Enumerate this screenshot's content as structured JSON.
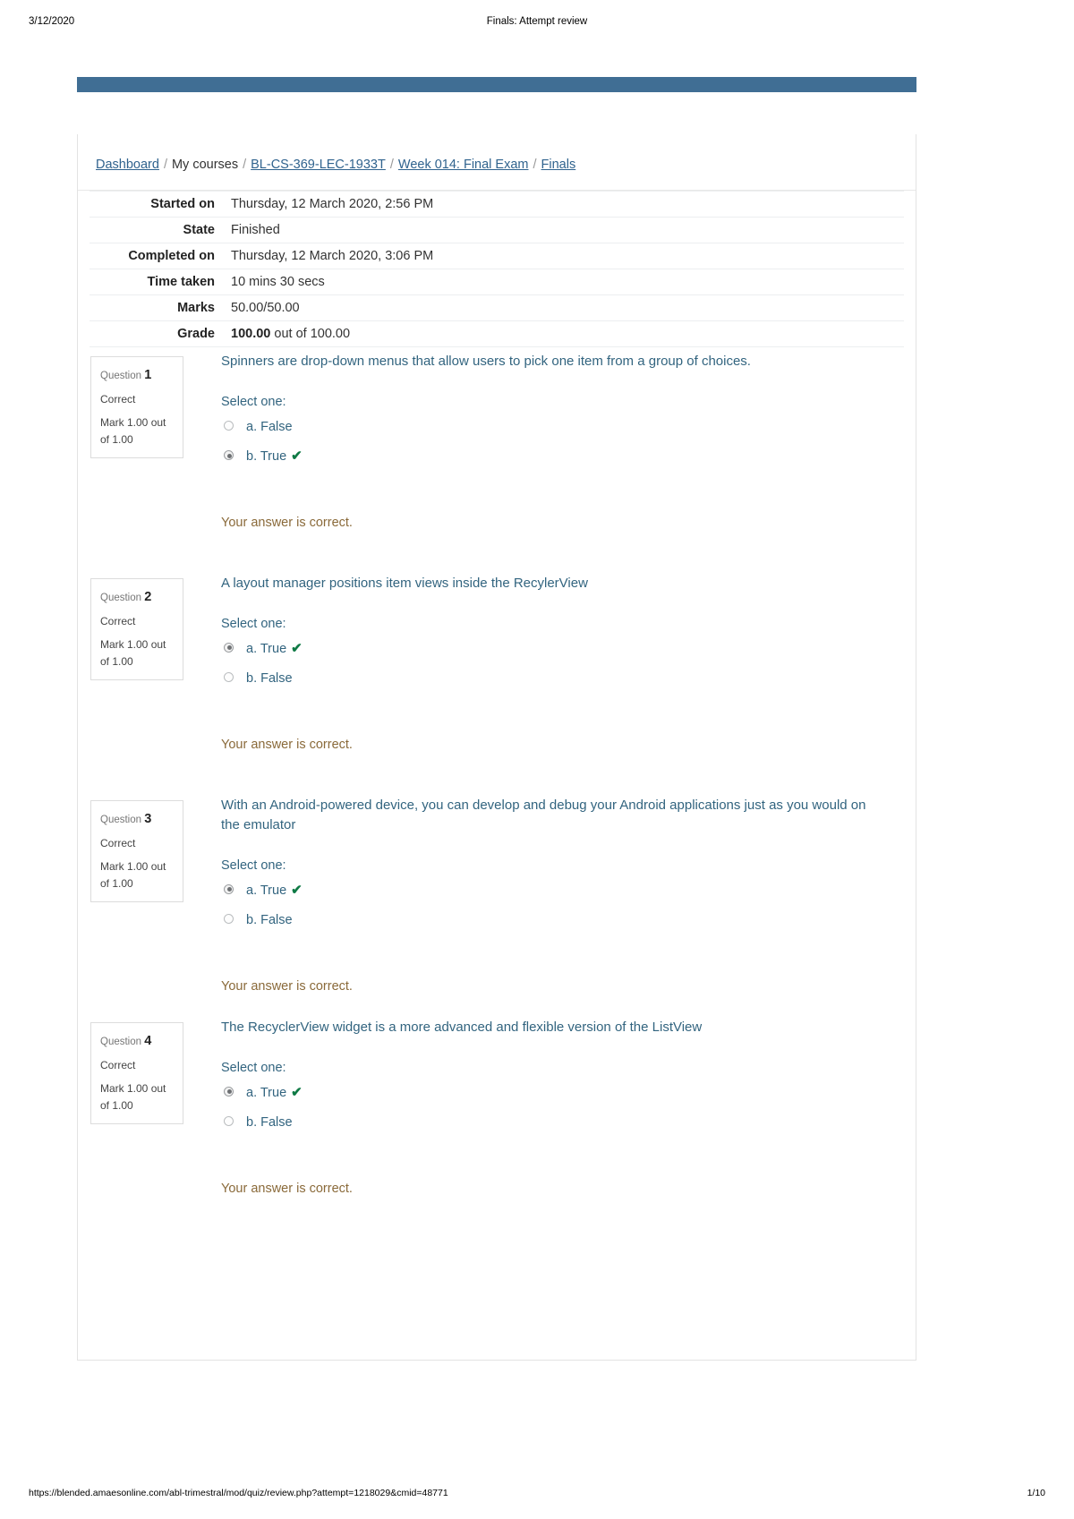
{
  "print_header": {
    "date": "3/12/2020",
    "title": "Finals: Attempt review"
  },
  "breadcrumb": {
    "items": [
      {
        "label": "Dashboard",
        "link": true
      },
      {
        "label": "My courses",
        "link": false
      },
      {
        "label": "BL-CS-369-LEC-1933T",
        "link": true
      },
      {
        "label": "Week 014: Final Exam",
        "link": true
      },
      {
        "label": "Finals",
        "link": true
      }
    ],
    "separator": "/"
  },
  "summary": {
    "rows": [
      {
        "label": "Started on",
        "value": "Thursday, 12 March 2020, 2:56 PM"
      },
      {
        "label": "State",
        "value": "Finished"
      },
      {
        "label": "Completed on",
        "value": "Thursday, 12 March 2020, 3:06 PM"
      },
      {
        "label": "Time taken",
        "value": "10 mins 30 secs"
      },
      {
        "label": "Marks",
        "value": "50.00/50.00"
      }
    ],
    "grade": {
      "label": "Grade",
      "bold_value": "100.00",
      "rest_value": " out of 100.00"
    }
  },
  "questions": [
    {
      "number_label": "Question",
      "number": "1",
      "state": "Correct",
      "mark": "Mark 1.00 out of 1.00",
      "text": "Spinners are drop-down menus that allow users to pick one item from a group of choices.",
      "select_label": "Select one:",
      "answers": [
        {
          "label": "a. False",
          "selected": false,
          "correct_tick": false
        },
        {
          "label": "b. True",
          "selected": true,
          "correct_tick": true
        }
      ],
      "feedback": "Your answer is correct."
    },
    {
      "number_label": "Question",
      "number": "2",
      "state": "Correct",
      "mark": "Mark 1.00 out of 1.00",
      "text": "A layout manager positions item views inside the RecylerView",
      "select_label": "Select one:",
      "answers": [
        {
          "label": "a. True",
          "selected": true,
          "correct_tick": true
        },
        {
          "label": "b. False",
          "selected": false,
          "correct_tick": false
        }
      ],
      "feedback": "Your answer is correct."
    },
    {
      "number_label": "Question",
      "number": "3",
      "state": "Correct",
      "mark": "Mark 1.00 out of 1.00",
      "text": "With an Android-powered device, you can develop and debug your Android applications just as you would on the emulator",
      "select_label": "Select one:",
      "answers": [
        {
          "label": "a. True",
          "selected": true,
          "correct_tick": true
        },
        {
          "label": "b. False",
          "selected": false,
          "correct_tick": false
        }
      ],
      "feedback": "Your answer is correct."
    },
    {
      "number_label": "Question",
      "number": "4",
      "state": "Correct",
      "mark": "Mark 1.00 out of 1.00",
      "text": "The RecyclerView widget is a more advanced and flexible version of the ListView",
      "select_label": "Select one:",
      "answers": [
        {
          "label": "a. True",
          "selected": true,
          "correct_tick": true
        },
        {
          "label": "b. False",
          "selected": false,
          "correct_tick": false
        }
      ],
      "feedback": "Your answer is correct."
    }
  ],
  "print_footer": {
    "url": "https://blended.amaesonline.com/abl-trimestral/mod/quiz/review.php?attempt=1218029&cmid=48771",
    "page": "1/10"
  },
  "colors": {
    "top_bar": "#406e94",
    "link": "#30638e",
    "question_text": "#32647f",
    "feedback": "#8a6a3a",
    "tick_green": "#0f7a45"
  },
  "icons": {
    "tick": "✔"
  }
}
